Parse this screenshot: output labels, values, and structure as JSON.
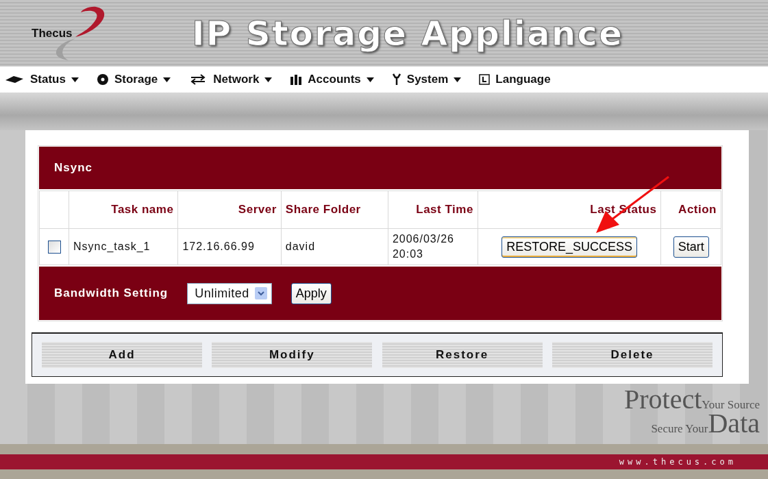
{
  "header": {
    "logo": "Thecus",
    "title": "IP Storage Appliance"
  },
  "menu": [
    {
      "label": "Status",
      "dropdown": true
    },
    {
      "label": "Storage",
      "dropdown": true
    },
    {
      "label": "Network",
      "dropdown": true
    },
    {
      "label": "Accounts",
      "dropdown": true
    },
    {
      "label": "System",
      "dropdown": true
    },
    {
      "label": "Language",
      "dropdown": false
    }
  ],
  "panel": {
    "title": "Nsync",
    "columns": [
      "Task name",
      "Server",
      "Share Folder",
      "Last Time",
      "Last Status",
      "Action"
    ],
    "rows": [
      {
        "checked": false,
        "task_name": "Nsync_task_1",
        "server": "172.16.66.99",
        "share_folder": "david",
        "last_time": [
          "2006/03/26",
          "20:03"
        ],
        "last_status": "RESTORE_SUCCESS",
        "action": "Start"
      }
    ],
    "bandwidth": {
      "label": "Bandwidth Setting",
      "value": "Unlimited",
      "apply": "Apply"
    },
    "buttons": [
      "Add",
      "Modify",
      "Restore",
      "Delete"
    ]
  },
  "slogan": {
    "protect": "Protect",
    "your_source": "Your Source",
    "secure_your": "Secure Your",
    "data": "Data"
  },
  "footer": {
    "url": "www.thecus.com"
  }
}
